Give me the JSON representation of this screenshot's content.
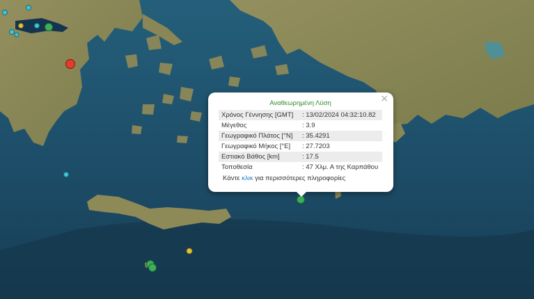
{
  "map": {
    "colors": {
      "sea": "#1d4a63",
      "land": "#8c8a58",
      "marker_red": "#e53b2c",
      "marker_green": "#3caf5a",
      "marker_cyan": "#3fc6d8",
      "marker_yellow": "#e3c23a"
    }
  },
  "popup": {
    "title": "Αναθεωρημένη Λύση",
    "close_icon": "×",
    "rows": [
      {
        "label": "Χρόνος Γέννησης [GMT]",
        "value": ": 13/02/2024 04:32:10.82"
      },
      {
        "label": "Μέγεθος",
        "value": ": 3.9"
      },
      {
        "label": "Γεωγραφικό Πλάτος [°N]",
        "value": ": 35.4291"
      },
      {
        "label": "Γεωγραφικό Μήκος [°E]",
        "value": ": 27.7203"
      },
      {
        "label": "Εστιακό Βάθος [km]",
        "value": ": 17.5"
      },
      {
        "label": "Τοποθεσία",
        "value": ": 47 Χλμ. Α της Καρπάθου"
      }
    ],
    "more_before": "Κάντε ",
    "more_link": "κλικ",
    "more_after": " για περισσότερες πληροφορίες"
  }
}
